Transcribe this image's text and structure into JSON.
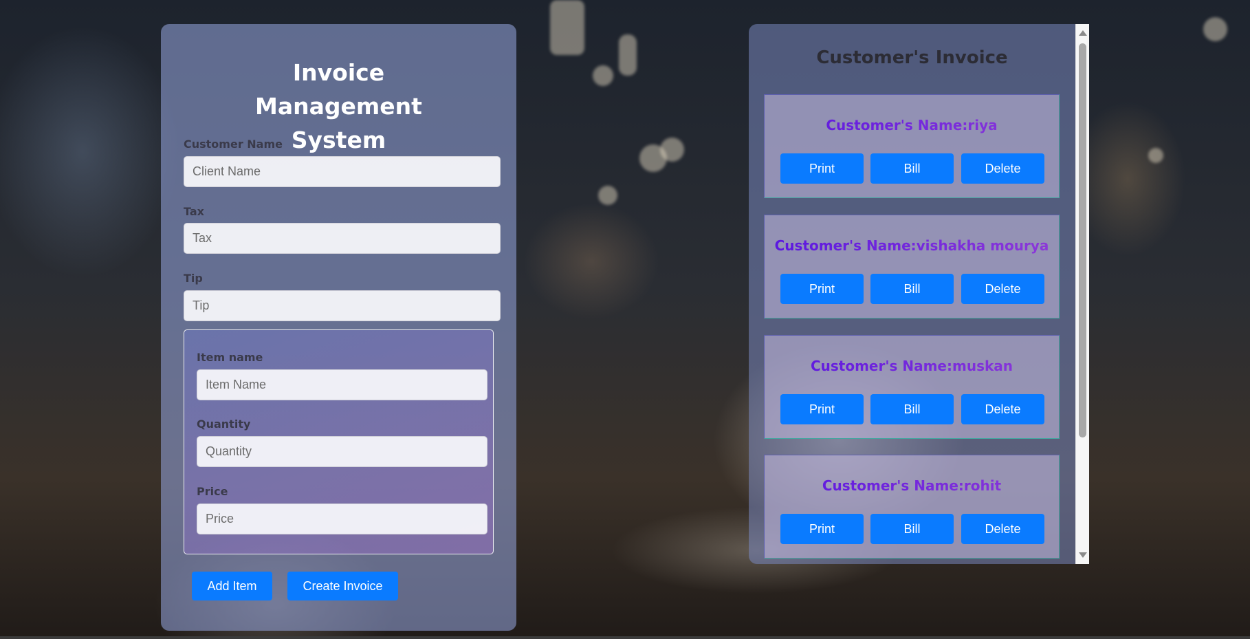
{
  "form": {
    "title": "Invoice Management System",
    "customer_name": {
      "label": "Customer Name",
      "placeholder": "Client Name"
    },
    "tax": {
      "label": "Tax",
      "placeholder": "Tax"
    },
    "tip": {
      "label": "Tip",
      "placeholder": "Tip"
    },
    "item": {
      "name": {
        "label": "Item name",
        "placeholder": "Item Name"
      },
      "quantity": {
        "label": "Quantity",
        "placeholder": "Quantity"
      },
      "price": {
        "label": "Price",
        "placeholder": "Price"
      }
    },
    "add_item_label": "Add Item",
    "create_invoice_label": "Create Invoice"
  },
  "invoices": {
    "title": "Customer's Invoice",
    "cards": [
      {
        "name": "Customer's Name:riya",
        "print": "Print",
        "bill": "Bill",
        "delete": "Delete"
      },
      {
        "name": "Customer's Name:vishakha mourya",
        "print": "Print",
        "bill": "Bill",
        "delete": "Delete"
      },
      {
        "name": "Customer's Name:muskan",
        "print": "Print",
        "bill": "Bill",
        "delete": "Delete"
      },
      {
        "name": "Customer's Name:rohit",
        "print": "Print",
        "bill": "Bill",
        "delete": "Delete"
      }
    ]
  },
  "colors": {
    "button": "#0a7bff",
    "customer_name_text": "#6a22e0"
  }
}
